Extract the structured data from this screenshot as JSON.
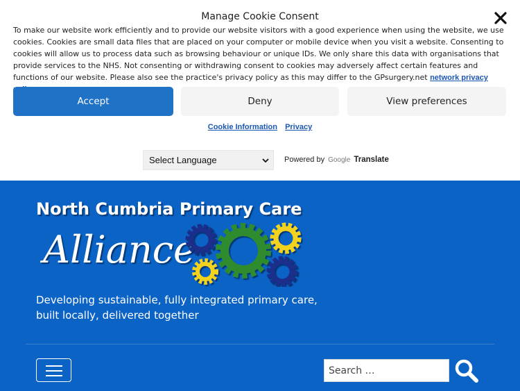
{
  "consent": {
    "title": "Manage Cookie Consent",
    "close_icon": "close-icon",
    "body": "To make our website work efficiently and to provide our website visitors with a good experience when using the website, we use cookies. Cookies are small data files that are placed on your computer or mobile device when you visit a website. Consenting to cookies will allow us to process data such as browsing behaviour or unique IDs. We only share this data with organisations that provide services to the NHS. Not consenting or withdrawing consent to cookies may adversely affect certain features and functions of our website. Please also see the practice's privacy policy as this may differ to the GPsurgery.net ",
    "body_link": "network privacy policy",
    "body_end": ".",
    "buttons": {
      "accept": "Accept",
      "deny": "Deny",
      "preferences": "View preferences"
    },
    "links": {
      "cookie_info": "Cookie Information",
      "privacy": "Privacy"
    }
  },
  "translate": {
    "select_value": "Select Language",
    "powered_by": "Powered by",
    "google": "Google",
    "translate": "Translate"
  },
  "header": {
    "logo_line1": "North Cumbria Primary Care",
    "logo_line2": "Alliance",
    "tagline": "Developing sustainable, fully integrated primary care, built locally, delivered together",
    "menu_icon": "hamburger-menu-icon",
    "search_placeholder": "Search …",
    "search_icon": "search-icon"
  },
  "colors": {
    "header_bg": "#0b63c6",
    "accept_bg": "#1f72c6",
    "link": "#1a57b5",
    "gear_green": "#2e8b2e",
    "gear_yellow": "#f2d21b",
    "gear_navy": "#1f2d8c"
  }
}
